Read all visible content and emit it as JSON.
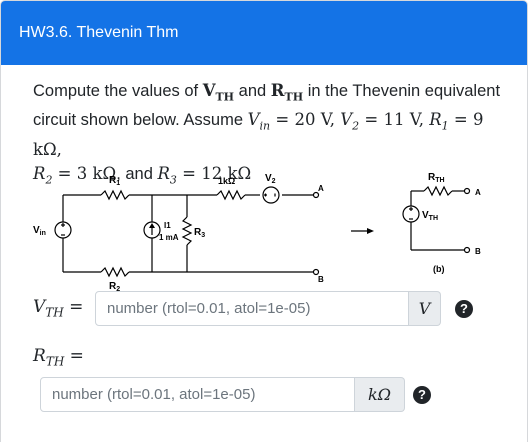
{
  "question": {
    "title": "HW3.6. Thevenin Thm",
    "prompt_line1_a": "Compute the values of ",
    "vth_sym": "V",
    "vth_sub": "TH",
    "and": " and ",
    "rth_sym": "R",
    "rth_sub": "TH",
    "prompt_line1_b": " in the Thevenin equivalent",
    "prompt_line2_a": "circuit shown below. Assume ",
    "vin_expr": "V",
    "vin_sub": "in",
    "vin_val": " = 20 V, ",
    "v2_expr": "V",
    "v2_sub": "2",
    "v2_val": " = 11 V, ",
    "r1_expr": "R",
    "r1_sub": "1",
    "r1_val": " = 9 kΩ,",
    "r2_expr": "R",
    "r2_sub": "2",
    "r2_val": " = 3 kΩ",
    "and2": ", and ",
    "r3_expr": "R",
    "r3_sub": "3",
    "r3_val": " = 12 kΩ"
  },
  "circuit": {
    "r1": "R",
    "r1_sub": "1",
    "r2": "R",
    "r2_sub": "2",
    "r3": "R",
    "r3_sub": "3",
    "vin": "V",
    "vin_sub": "in",
    "i1": "I1",
    "i1_val": "1 mA",
    "res_1k": "1kΩ",
    "v2": "V",
    "v2_sub": "2",
    "node_a": "A",
    "node_b": "B",
    "rth": "R",
    "rth_sub": "TH",
    "vth": "V",
    "vth_sub": "TH",
    "label_b": "(b)"
  },
  "answers": {
    "vth_label": "V",
    "vth_label_sub": "TH",
    "vth_placeholder": "number (rtol=0.01, atol=1e-05)",
    "vth_unit": "V",
    "rth_label": "R",
    "rth_label_sub": "TH",
    "rth_placeholder": "number (rtol=0.01, atol=1e-05)",
    "rth_unit": "kΩ",
    "help": "?",
    "equals": " ="
  },
  "colors": {
    "header_bg": "#1473e6",
    "unit_bg": "#e9ecef"
  }
}
